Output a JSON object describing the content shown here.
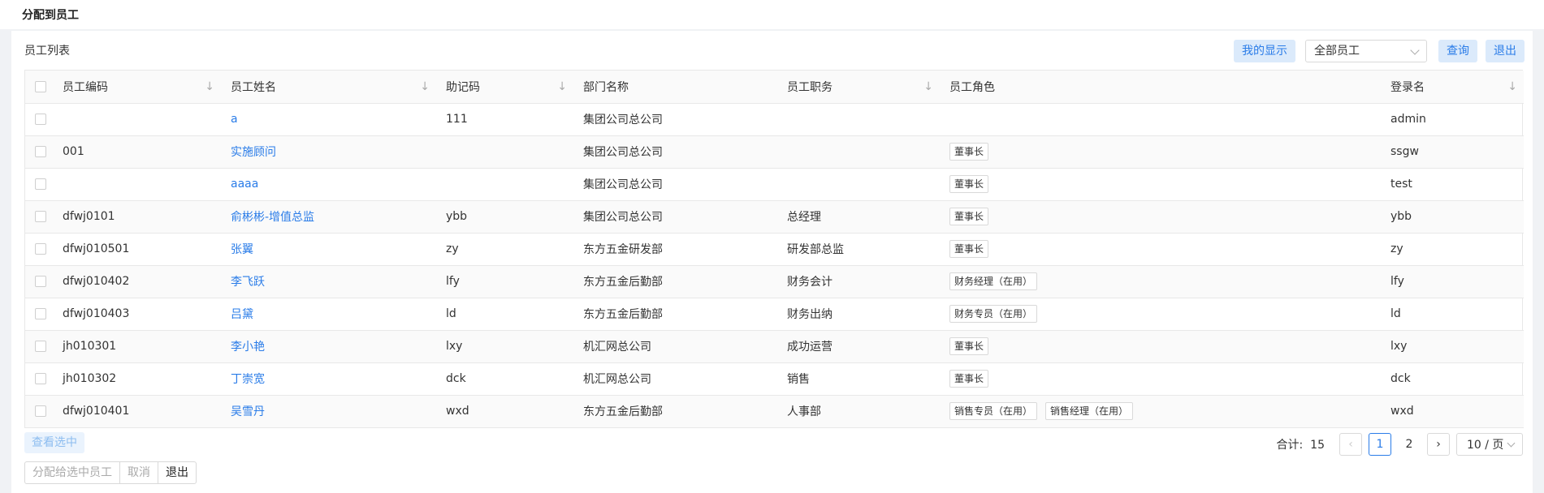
{
  "header": {
    "title": "分配到员工"
  },
  "toolbar": {
    "list_title": "员工列表",
    "my_display": "我的显示",
    "filter_value": "全部员工",
    "query": "查询",
    "exit": "退出"
  },
  "table": {
    "columns": [
      "员工编码",
      "员工姓名",
      "助记码",
      "部门名称",
      "员工职务",
      "员工角色",
      "登录名"
    ],
    "rows": [
      {
        "code": "",
        "name": "a",
        "mnemonic": "111",
        "dept": "集团公司总公司",
        "title": "",
        "roles": [],
        "login": "admin"
      },
      {
        "code": "001",
        "name": "实施顾问",
        "mnemonic": "",
        "dept": "集团公司总公司",
        "title": "",
        "roles": [
          "董事长"
        ],
        "login": "ssgw"
      },
      {
        "code": "",
        "name": "aaaa",
        "mnemonic": "",
        "dept": "集团公司总公司",
        "title": "",
        "roles": [
          "董事长"
        ],
        "login": "test"
      },
      {
        "code": "dfwj0101",
        "name": "俞彬彬-增值总监",
        "mnemonic": "ybb",
        "dept": "集团公司总公司",
        "title": "总经理",
        "roles": [
          "董事长"
        ],
        "login": "ybb"
      },
      {
        "code": "dfwj010501",
        "name": "张翼",
        "mnemonic": "zy",
        "dept": "东方五金研发部",
        "title": "研发部总监",
        "roles": [
          "董事长"
        ],
        "login": "zy"
      },
      {
        "code": "dfwj010402",
        "name": "李飞跃",
        "mnemonic": "lfy",
        "dept": "东方五金后勤部",
        "title": "财务会计",
        "roles": [
          "财务经理（在用）"
        ],
        "login": "lfy"
      },
      {
        "code": "dfwj010403",
        "name": "吕黛",
        "mnemonic": "ld",
        "dept": "东方五金后勤部",
        "title": "财务出纳",
        "roles": [
          "财务专员（在用）"
        ],
        "login": "ld"
      },
      {
        "code": "jh010301",
        "name": "李小艳",
        "mnemonic": "lxy",
        "dept": "机汇网总公司",
        "title": "成功运营",
        "roles": [
          "董事长"
        ],
        "login": "lxy"
      },
      {
        "code": "jh010302",
        "name": "丁崇宽",
        "mnemonic": "dck",
        "dept": "机汇网总公司",
        "title": "销售",
        "roles": [
          "董事长"
        ],
        "login": "dck"
      },
      {
        "code": "dfwj010401",
        "name": "吴雪丹",
        "mnemonic": "wxd",
        "dept": "东方五金后勤部",
        "title": "人事部",
        "roles": [
          "销售专员（在用）",
          "销售经理（在用）"
        ],
        "login": "wxd"
      }
    ]
  },
  "footer": {
    "view_selected": "查看选中",
    "total_label": "合计:",
    "total_value": "15",
    "pages": [
      "1",
      "2"
    ],
    "page_size": "10 / 页",
    "assign": "分配给选中员工",
    "cancel": "取消",
    "exit": "退出"
  }
}
